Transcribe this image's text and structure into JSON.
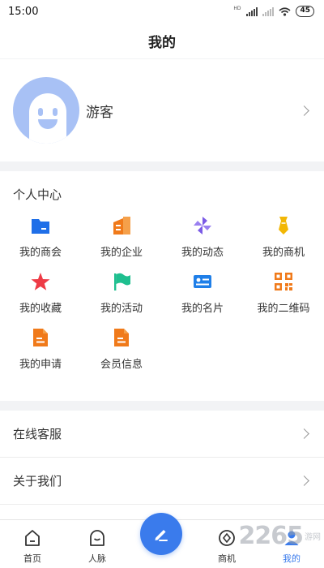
{
  "status_bar": {
    "time": "15:00",
    "network_tag": "HD",
    "battery": "45"
  },
  "header": {
    "title": "我的"
  },
  "profile": {
    "name": "游客"
  },
  "personal_center": {
    "title": "个人中心",
    "items": [
      {
        "label": "我的商会",
        "icon": "folder-icon",
        "color": "#1f6fe8"
      },
      {
        "label": "我的企业",
        "icon": "building-icon",
        "color": "#f07a1a"
      },
      {
        "label": "我的动态",
        "icon": "pinwheel-icon",
        "color": "#7b5be6"
      },
      {
        "label": "我的商机",
        "icon": "tie-icon",
        "color": "#f2b705"
      },
      {
        "label": "我的收藏",
        "icon": "star-icon",
        "color": "#ee3b46"
      },
      {
        "label": "我的活动",
        "icon": "flag-icon",
        "color": "#1fbf8f"
      },
      {
        "label": "我的名片",
        "icon": "card-icon",
        "color": "#1f7fe8"
      },
      {
        "label": "我的二维码",
        "icon": "qrcode-icon",
        "color": "#f07a1a"
      },
      {
        "label": "我的申请",
        "icon": "document-icon",
        "color": "#f07a1a"
      },
      {
        "label": "会员信息",
        "icon": "document-icon",
        "color": "#f07a1a"
      }
    ]
  },
  "menu": {
    "items": [
      {
        "label": "在线客服"
      },
      {
        "label": "关于我们"
      }
    ]
  },
  "tab_bar": {
    "tabs": [
      {
        "label": "首页"
      },
      {
        "label": "人脉"
      },
      {
        "label": ""
      },
      {
        "label": "商机"
      },
      {
        "label": "我的"
      }
    ],
    "accent": "#3a7bec"
  },
  "watermark": {
    "number": "2265",
    "text": "游网"
  }
}
